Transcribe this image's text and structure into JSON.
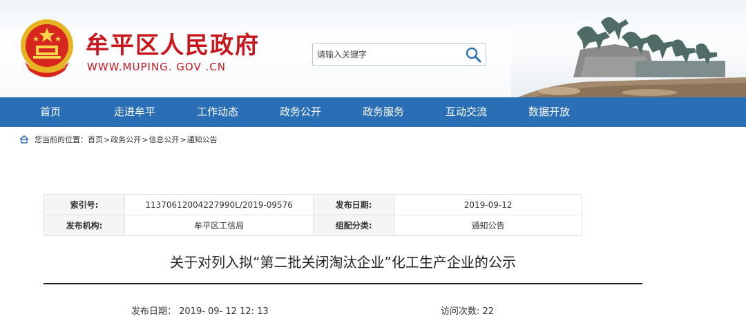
{
  "header": {
    "site_title": "牟平区人民政府",
    "site_url": "WWW.MUPING. GOV .CN",
    "search_placeholder": "请输入关键字"
  },
  "nav": {
    "items": [
      "首页",
      "走进牟平",
      "工作动态",
      "政务公开",
      "政务服务",
      "互动交流",
      "数据开放"
    ]
  },
  "breadcrumb": {
    "prefix": "您当前的位置：",
    "items": [
      "首页",
      "政务公开",
      "信息公开",
      "通知公告"
    ],
    "separator": ">"
  },
  "meta": {
    "index_label": "索引号:",
    "index_value": "11370612004227990L/2019-09576",
    "date_label": "发布日期:",
    "date_value": "2019-09-12",
    "org_label": "发布机构:",
    "org_value": "牟平区工信局",
    "category_label": "组配分类:",
    "category_value": "通知公告"
  },
  "article": {
    "title": "关于对列入拟“第二批关闭淘汰企业”化工生产企业的公示",
    "publish_line": "发布日期： 2019- 09- 12 12: 13",
    "visits": "访问次数: 22"
  },
  "colors": {
    "brand_red": "#c8161d",
    "nav_blue": "#2a6fb6"
  },
  "icons": {
    "search": "search-icon",
    "home": "home-icon",
    "emblem": "national-emblem"
  }
}
